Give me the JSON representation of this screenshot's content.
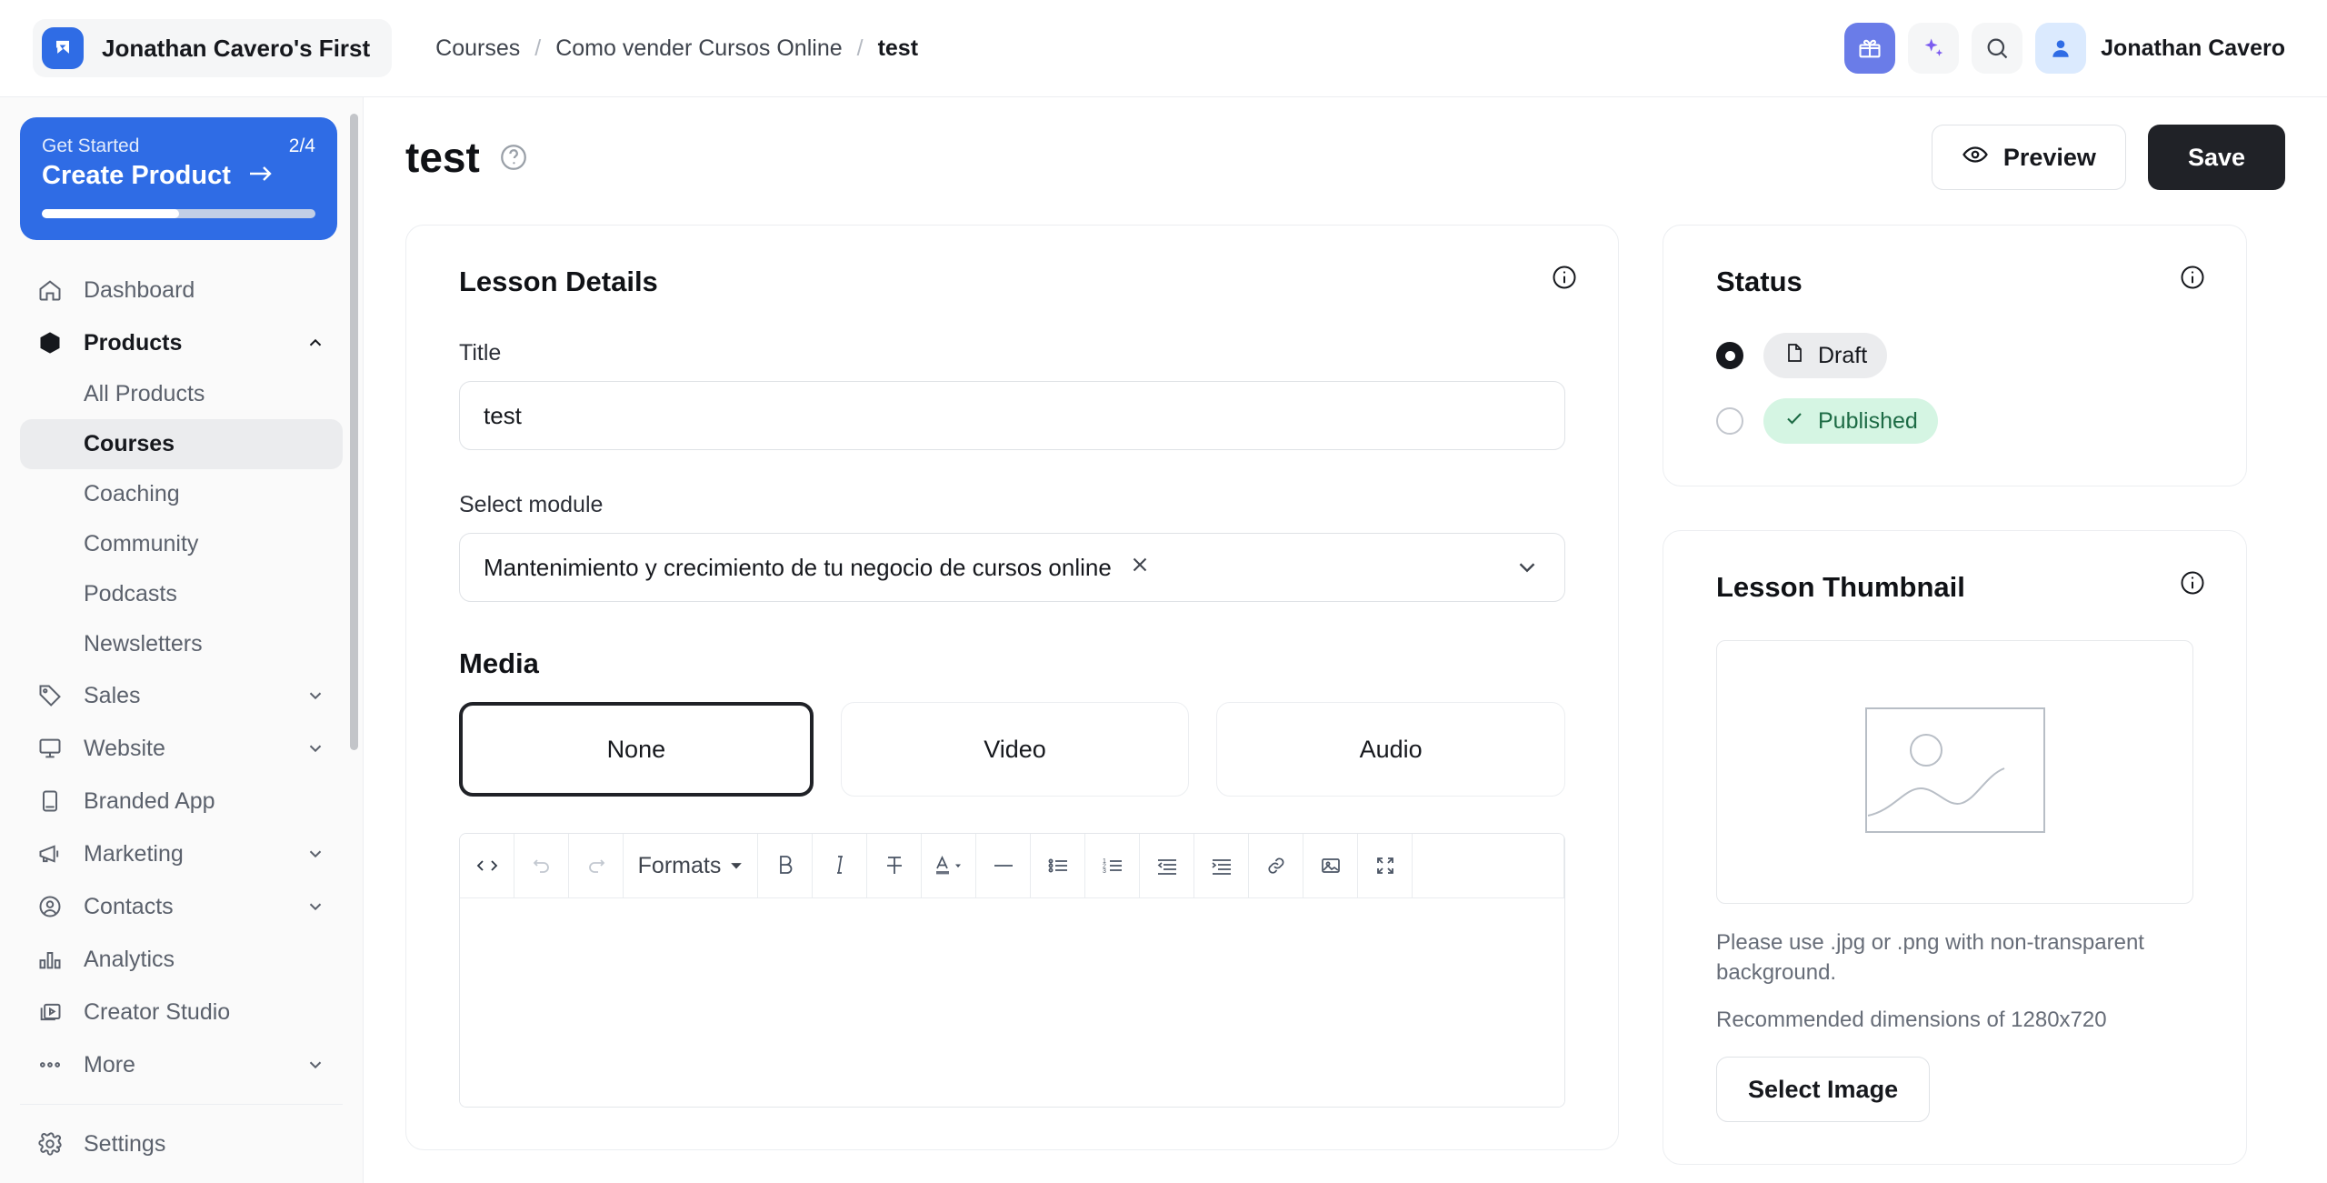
{
  "topbar": {
    "workspace_name": "Jonathan Cavero's First",
    "breadcrumb": [
      {
        "label": "Courses",
        "current": false
      },
      {
        "label": "Como vender Cursos Online",
        "current": false
      },
      {
        "label": "test",
        "current": true
      }
    ],
    "separator": "/",
    "user_name": "Jonathan Cavero",
    "icons": {
      "logo": "workspace-logo-icon",
      "gift": "gift-icon",
      "sparkles": "sparkles-icon",
      "search": "search-icon",
      "avatar": "user-avatar-icon"
    },
    "colors": {
      "logo_bg": "#2f6ce5",
      "gift_bg": "#6a7ce8",
      "sparkles_color": "#7c5cf0",
      "avatar_bg": "#dbeafe"
    }
  },
  "sidebar": {
    "get_started": {
      "label": "Get Started",
      "count": "2/4",
      "title": "Create Product",
      "arrow_icon": "arrow-right-icon",
      "progress_percent": 50,
      "bg_color": "#2f6ce5"
    },
    "items": [
      {
        "label": "Dashboard",
        "icon": "home-icon",
        "expandable": false,
        "active": false
      },
      {
        "label": "Products",
        "icon": "box-icon",
        "expandable": true,
        "expanded": true,
        "active": true
      },
      {
        "label": "Sales",
        "icon": "tag-icon",
        "expandable": true,
        "expanded": false,
        "active": false
      },
      {
        "label": "Website",
        "icon": "monitor-icon",
        "expandable": true,
        "expanded": false,
        "active": false
      },
      {
        "label": "Branded App",
        "icon": "mobile-icon",
        "expandable": false,
        "active": false
      },
      {
        "label": "Marketing",
        "icon": "megaphone-icon",
        "expandable": true,
        "expanded": false,
        "active": false
      },
      {
        "label": "Contacts",
        "icon": "user-circle-icon",
        "expandable": true,
        "expanded": false,
        "active": false
      },
      {
        "label": "Analytics",
        "icon": "bar-chart-icon",
        "expandable": false,
        "active": false
      },
      {
        "label": "Creator Studio",
        "icon": "video-library-icon",
        "expandable": false,
        "active": false
      },
      {
        "label": "More",
        "icon": "ellipsis-icon",
        "expandable": true,
        "expanded": false,
        "active": false
      }
    ],
    "products_children": [
      {
        "label": "All Products",
        "selected": false
      },
      {
        "label": "Courses",
        "selected": true
      },
      {
        "label": "Coaching",
        "selected": false
      },
      {
        "label": "Community",
        "selected": false
      },
      {
        "label": "Podcasts",
        "selected": false
      },
      {
        "label": "Newsletters",
        "selected": false
      }
    ],
    "settings": {
      "label": "Settings",
      "icon": "gear-icon"
    }
  },
  "page": {
    "title": "test",
    "help_icon": "question-circle-icon",
    "preview_label": "Preview",
    "preview_icon": "eye-icon",
    "save_label": "Save"
  },
  "lesson_details": {
    "card_title": "Lesson Details",
    "info_icon": "info-circle-icon",
    "title_label": "Title",
    "title_value": "test",
    "title_placeholder": "Lesson title",
    "module_label": "Select module",
    "module_value": "Mantenimiento y crecimiento de tu negocio de cursos online",
    "module_clear_icon": "close-icon",
    "module_chevron_icon": "chevron-down-icon",
    "media_label": "Media",
    "media_options": [
      {
        "label": "None",
        "selected": true
      },
      {
        "label": "Video",
        "selected": false
      },
      {
        "label": "Audio",
        "selected": false
      }
    ],
    "editor_toolbar": [
      {
        "name": "source-code-icon",
        "glyph": "</>",
        "kind": "icon",
        "disabled": false
      },
      {
        "name": "undo-icon",
        "glyph": "",
        "kind": "icon",
        "disabled": true
      },
      {
        "name": "redo-icon",
        "glyph": "",
        "kind": "icon",
        "disabled": true
      },
      {
        "name": "formats-dropdown",
        "glyph": "Formats",
        "kind": "text",
        "disabled": false
      },
      {
        "name": "bold-icon",
        "glyph": "B",
        "kind": "icon",
        "disabled": false
      },
      {
        "name": "italic-icon",
        "glyph": "I",
        "kind": "icon",
        "disabled": false
      },
      {
        "name": "strikethrough-icon",
        "glyph": "",
        "kind": "icon",
        "disabled": false
      },
      {
        "name": "text-color-icon",
        "glyph": "A",
        "kind": "icon",
        "disabled": false
      },
      {
        "name": "horizontal-rule-icon",
        "glyph": "",
        "kind": "icon",
        "disabled": false
      },
      {
        "name": "bullet-list-icon",
        "glyph": "",
        "kind": "icon",
        "disabled": false
      },
      {
        "name": "numbered-list-icon",
        "glyph": "",
        "kind": "icon",
        "disabled": false
      },
      {
        "name": "outdent-icon",
        "glyph": "",
        "kind": "icon",
        "disabled": false
      },
      {
        "name": "indent-icon",
        "glyph": "",
        "kind": "icon",
        "disabled": false
      },
      {
        "name": "link-icon",
        "glyph": "",
        "kind": "icon",
        "disabled": false
      },
      {
        "name": "image-icon",
        "glyph": "",
        "kind": "icon",
        "disabled": false
      },
      {
        "name": "fullscreen-icon",
        "glyph": "",
        "kind": "icon",
        "disabled": false
      }
    ],
    "editor_content": ""
  },
  "status_panel": {
    "card_title": "Status",
    "info_icon": "info-circle-icon",
    "options": [
      {
        "label": "Draft",
        "selected": true,
        "icon": "document-icon",
        "color": "#16181d",
        "bg": "#ebecee"
      },
      {
        "label": "Published",
        "selected": false,
        "icon": "check-icon",
        "color": "#1d6b45",
        "bg": "#d5f5e3"
      }
    ]
  },
  "thumbnail_panel": {
    "card_title": "Lesson Thumbnail",
    "info_icon": "info-circle-icon",
    "placeholder_icon": "image-placeholder-icon",
    "help_text": "Please use .jpg or .png with non-transparent background.",
    "dimensions_text": "Recommended dimensions of 1280x720",
    "select_image_label": "Select Image"
  }
}
